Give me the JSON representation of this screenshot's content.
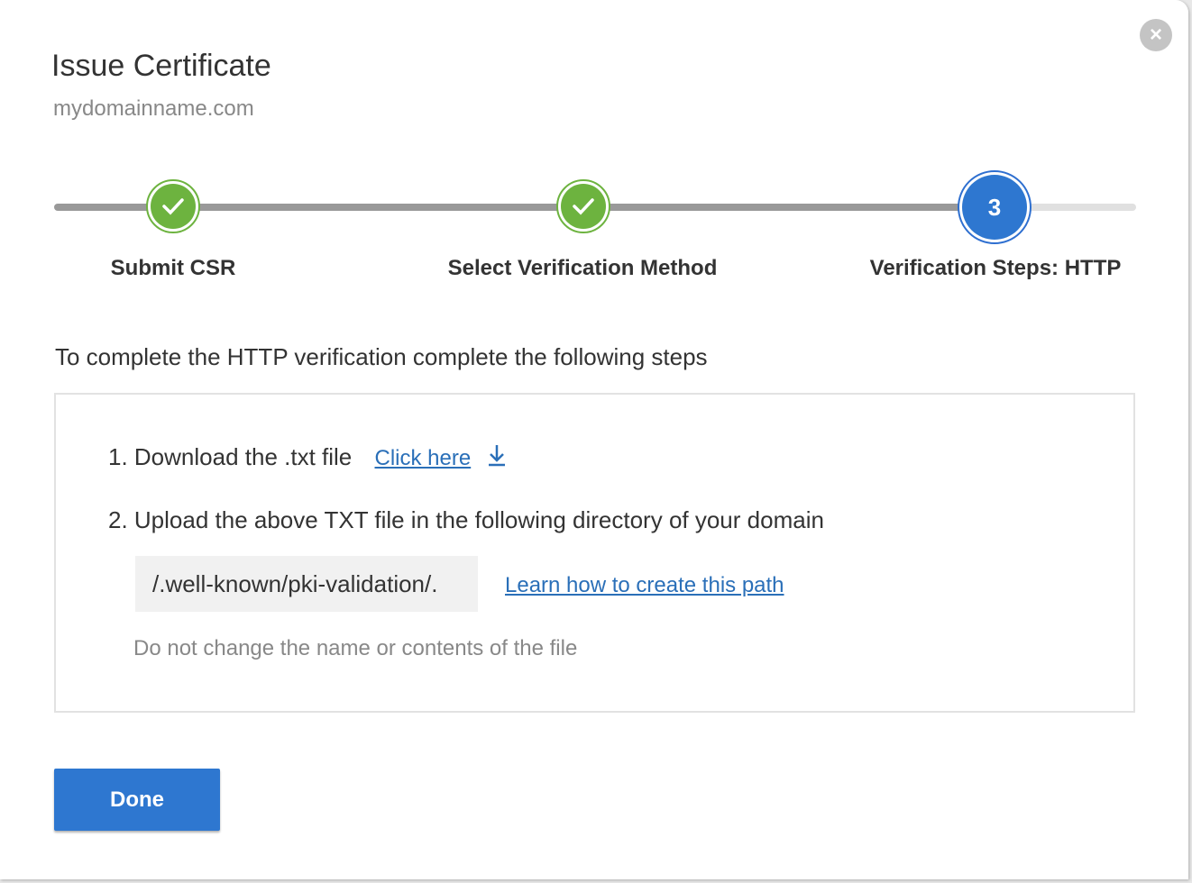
{
  "dialog": {
    "title": "Issue Certificate",
    "subtitle": "mydomainname.com",
    "close_icon": "close-circle-icon"
  },
  "stepper": {
    "steps": [
      {
        "label": "Submit CSR",
        "status": "complete"
      },
      {
        "label": "Select Verification Method",
        "status": "complete"
      },
      {
        "label": "Verification Steps: HTTP",
        "status": "current",
        "number": "3"
      }
    ]
  },
  "colors": {
    "complete": "#6db33f",
    "current": "#2e77d0",
    "link": "#2a6fb8"
  },
  "content": {
    "intro": "To complete the HTTP verification complete the following steps",
    "step1": "1. Download the .txt file",
    "step1_link": "Click here",
    "step2": "2. Upload the above TXT file in the following directory of your domain",
    "path": "/.well-known/pki-validation/.",
    "path_link": "Learn how to create this path",
    "note": "Do not change the name or contents of the file"
  },
  "footer": {
    "done_label": "Done"
  }
}
